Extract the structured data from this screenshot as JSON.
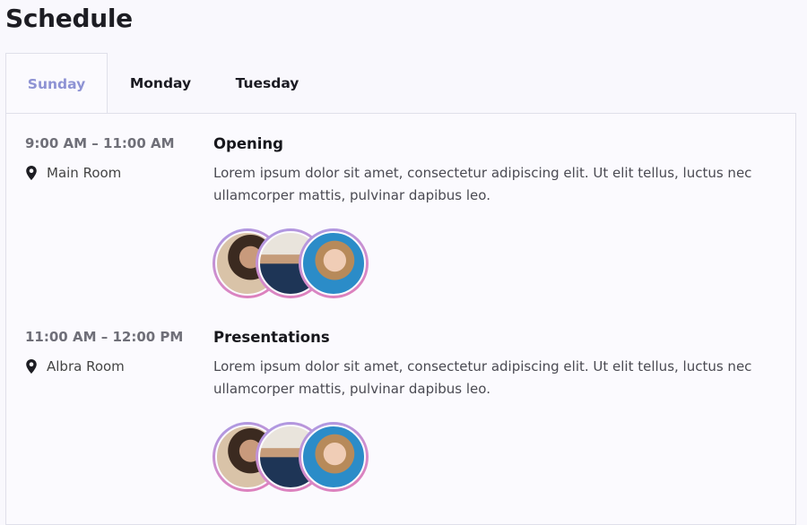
{
  "page": {
    "title": "Schedule"
  },
  "tabs": [
    {
      "label": "Sunday",
      "active": true
    },
    {
      "label": "Monday",
      "active": false
    },
    {
      "label": "Tuesday",
      "active": false
    }
  ],
  "sessions": [
    {
      "time": "9:00 AM – 11:00 AM",
      "location": "Main Room",
      "title": "Opening",
      "description": "Lorem ipsum dolor sit amet, consectetur adipiscing elit. Ut elit tellus, luctus nec ullamcorper mattis, pulvinar dapibus leo."
    },
    {
      "time": "11:00 AM – 12:00 PM",
      "location": "Albra Room",
      "title": "Presentations",
      "description": "Lorem ipsum dolor sit amet, consectetur adipiscing elit. Ut elit tellus, luctus nec ullamcorper mattis, pulvinar dapibus leo."
    }
  ],
  "colors": {
    "accent": "#8e93d4",
    "avatar_ring_start": "#a79be6",
    "avatar_ring_end": "#e07cb8"
  },
  "icons": {
    "location": "map-pin-icon"
  }
}
